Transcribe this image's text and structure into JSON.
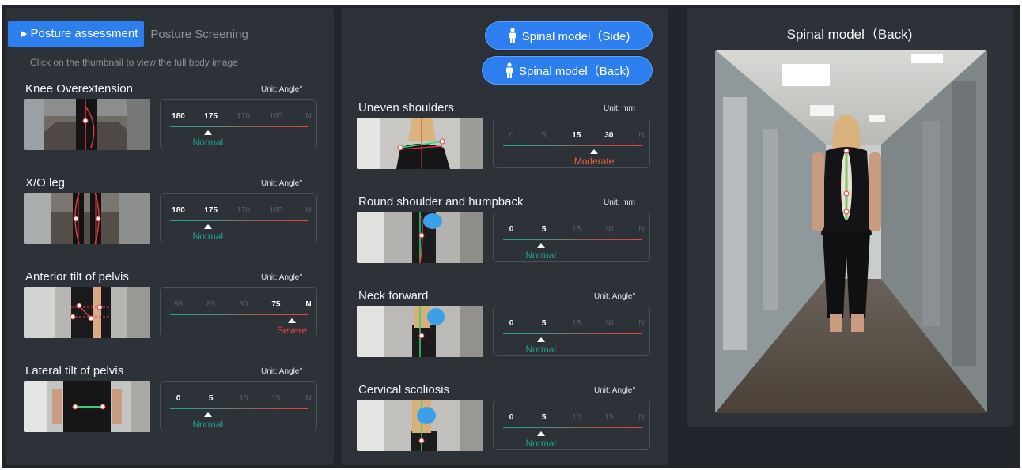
{
  "tabs": {
    "active": "Posture assessment",
    "inactive": "Posture Screening"
  },
  "hint": "Click on the thumbnail to view the full body image",
  "left_cards": [
    {
      "title": "Knee Overextension",
      "unit": "Unit: Angle°",
      "ticks": [
        "180",
        "175",
        "170",
        "165",
        "N"
      ],
      "active_ticks": [
        0,
        1
      ],
      "marker": 0.27,
      "status": "Normal",
      "status_color": "#1fa38f"
    },
    {
      "title": "X/O leg",
      "unit": "Unit: Angle°",
      "ticks": [
        "180",
        "175",
        "170",
        "165",
        "N"
      ],
      "active_ticks": [
        0,
        1
      ],
      "marker": 0.27,
      "status": "Normal",
      "status_color": "#1fa38f"
    },
    {
      "title": "Anterior tilt of pelvis",
      "unit": "Unit: Angle°",
      "ticks": [
        "95",
        "85",
        "80",
        "75",
        "N"
      ],
      "active_ticks": [
        3,
        4
      ],
      "marker": 0.87,
      "status": "Severe",
      "status_color": "#e8453c"
    },
    {
      "title": "Lateral tilt of pelvis",
      "unit": "Unit: Angle°",
      "ticks": [
        "0",
        "5",
        "10",
        "15",
        "N"
      ],
      "active_ticks": [
        0,
        1
      ],
      "marker": 0.27,
      "status": "Normal",
      "status_color": "#1fa38f"
    }
  ],
  "mid_buttons": {
    "side": "Spinal model（Side)",
    "back": "Spinal model（Back)"
  },
  "mid_cards": [
    {
      "title": "Uneven shoulders",
      "unit": "Unit: mm",
      "ticks": [
        "0",
        "5",
        "15",
        "30",
        "N"
      ],
      "active_ticks": [
        2,
        3
      ],
      "marker": 0.65,
      "status": "Moderate",
      "status_color": "#e8603c"
    },
    {
      "title": "Round shoulder and humpback",
      "unit": "Unit: mm",
      "ticks": [
        "0",
        "5",
        "15",
        "30",
        "N"
      ],
      "active_ticks": [
        0,
        1
      ],
      "marker": 0.27,
      "status": "Normal",
      "status_color": "#1fa38f"
    },
    {
      "title": "Neck forward",
      "unit": "Unit: Angle°",
      "ticks": [
        "0",
        "5",
        "15",
        "30",
        "N"
      ],
      "active_ticks": [
        0,
        1
      ],
      "marker": 0.27,
      "status": "Normal",
      "status_color": "#1fa38f"
    },
    {
      "title": "Cervical scoliosis",
      "unit": "Unit: Angle°",
      "ticks": [
        "0",
        "5",
        "10",
        "15",
        "N"
      ],
      "active_ticks": [
        0,
        1
      ],
      "marker": 0.27,
      "status": "Normal",
      "status_color": "#1fa38f"
    }
  ],
  "right": {
    "title": "Spinal model（Back)"
  },
  "colors": {
    "accent": "#2d7ff0",
    "normal": "#1fa38f",
    "severe": "#e8453c",
    "panel": "#2d3138",
    "background": "#22252b"
  }
}
